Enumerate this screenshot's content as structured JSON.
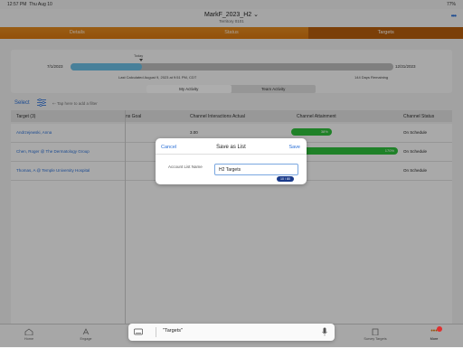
{
  "status": {
    "time": "12:57 PM",
    "date": "Thu Aug 10",
    "battery": "77%"
  },
  "nav": {
    "title": "MarkF_2023_H2",
    "subtitle": "Territory 0101"
  },
  "tabs": [
    "Details",
    "Status",
    "Targets"
  ],
  "progress": {
    "today_label": "Today",
    "start": "7/1/2023",
    "end": "12/31/2023",
    "fraction": 0.22,
    "last_calculated": "Last Calculated August 9, 2023 at 9:51 PM, CDT",
    "remaining": "144 Days Remaining"
  },
  "segment": {
    "my": "My Activity",
    "team": "Team Activity"
  },
  "filter": {
    "select": "Select",
    "placeholder": "Tap here to add a filter"
  },
  "table": {
    "headers": {
      "target": "Target (3)",
      "goal": "ns Goal",
      "actual": "Channel Interactions Actual",
      "attain": "Channel Attainment",
      "status": "Channel Status"
    },
    "rows": [
      {
        "target": "Andrzejewski, Anna",
        "actual": "3.00",
        "attain": "38%",
        "attain_frac": 0.38,
        "status": "On Schedule"
      },
      {
        "target": "Chen, Roger @ The Dermatology Group",
        "actual": "",
        "attain": "170%",
        "attain_frac": 1.0,
        "status": "On Schedule"
      },
      {
        "target": "Thomas, A @ Temple University Hospital",
        "actual": "",
        "attain": "",
        "attain_frac": 0,
        "status": "On Schedule"
      }
    ]
  },
  "modal": {
    "cancel": "Cancel",
    "title": "Save as List",
    "save": "Save",
    "field_label": "Account List Name",
    "field_value": "H2 Targets",
    "counter": "10 / 80"
  },
  "keyboard": {
    "suggestion": "\"Targets\""
  },
  "tabbar": [
    "Home",
    "Engage",
    "Survey Targets",
    "More"
  ],
  "colors": {
    "accent": "#2a6fd6",
    "tabs": "#d97810",
    "progress": "#6bbde3",
    "attain": "#2fbf3b"
  }
}
